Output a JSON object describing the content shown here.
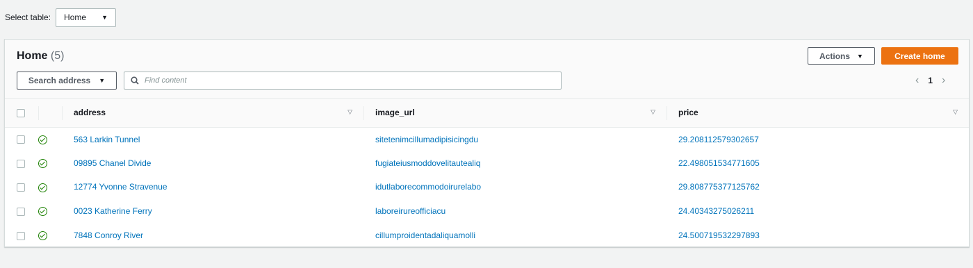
{
  "table_select": {
    "label": "Select table:",
    "value": "Home"
  },
  "panel": {
    "title": "Home",
    "count": "(5)",
    "actions_label": "Actions",
    "create_label": "Create home",
    "search_property_label": "Search address",
    "search_placeholder": "Find content",
    "page": "1"
  },
  "columns": [
    "address",
    "image_url",
    "price"
  ],
  "rows": [
    {
      "address": "563 Larkin Tunnel",
      "image_url": "sitetenimcillumadipisicingdu",
      "price": "29.208112579302657"
    },
    {
      "address": "09895 Chanel Divide",
      "image_url": "fugiateiusmoddovelitautealiq",
      "price": "22.498051534771605"
    },
    {
      "address": "12774 Yvonne Stravenue",
      "image_url": "idutlaborecommodoirurelabo",
      "price": "29.808775377125762"
    },
    {
      "address": "0023 Katherine Ferry",
      "image_url": "laboreirureofficiacu",
      "price": "24.40343275026211"
    },
    {
      "address": "7848 Conroy River",
      "image_url": "cillumproidentadaliquamolli",
      "price": "24.500719532297893"
    }
  ],
  "colors": {
    "accent": "#ec7211",
    "link": "#0073bb",
    "success": "#1d8102"
  }
}
